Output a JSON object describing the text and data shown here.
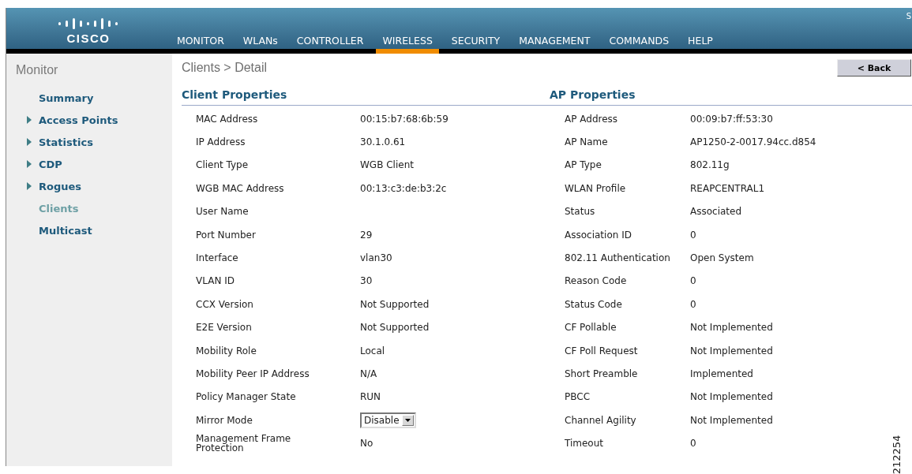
{
  "header": {
    "logo": "CISCO",
    "corner_text": "S",
    "menu": [
      {
        "label": "MONITOR",
        "selected": false
      },
      {
        "label": "WLANs",
        "selected": false
      },
      {
        "label": "CONTROLLER",
        "selected": false
      },
      {
        "label": "WIRELESS",
        "selected": true
      },
      {
        "label": "SECURITY",
        "selected": false
      },
      {
        "label": "MANAGEMENT",
        "selected": false
      },
      {
        "label": "COMMANDS",
        "selected": false
      },
      {
        "label": "HELP",
        "selected": false
      }
    ]
  },
  "sidebar": {
    "title": "Monitor",
    "items": [
      {
        "label": "Summary",
        "expandable": false,
        "selected": false
      },
      {
        "label": "Access Points",
        "expandable": true,
        "selected": false
      },
      {
        "label": "Statistics",
        "expandable": true,
        "selected": false
      },
      {
        "label": "CDP",
        "expandable": true,
        "selected": false
      },
      {
        "label": "Rogues",
        "expandable": true,
        "selected": false
      },
      {
        "label": "Clients",
        "expandable": false,
        "selected": true
      },
      {
        "label": "Multicast",
        "expandable": false,
        "selected": false
      }
    ]
  },
  "page": {
    "breadcrumb": "Clients > Detail",
    "back_button": "< Back",
    "sections": [
      {
        "title": "Client Properties",
        "rows": [
          {
            "label": "MAC Address",
            "value": "00:15:b7:68:6b:59"
          },
          {
            "label": "IP Address",
            "value": "30.1.0.61"
          },
          {
            "label": "Client Type",
            "value": "WGB Client"
          },
          {
            "label": "WGB MAC Address",
            "value": "00:13:c3:de:b3:2c"
          },
          {
            "label": "User Name"
          },
          {
            "label": "Port Number",
            "value": "29"
          },
          {
            "label": "Interface",
            "value": "vlan30"
          },
          {
            "label": "VLAN ID",
            "value": "30"
          },
          {
            "label": "CCX Version",
            "value": "Not Supported"
          },
          {
            "label": "E2E Version",
            "value": "Not Supported"
          },
          {
            "label": "Mobility Role",
            "value": "Local"
          },
          {
            "label": "Mobility Peer IP Address",
            "value": "N/A"
          },
          {
            "label": "Policy Manager State",
            "value": "RUN"
          },
          {
            "label": "Mirror Mode",
            "value": "Disable",
            "kind": "select"
          },
          {
            "label": "Management Frame Protection",
            "value": "No"
          }
        ]
      },
      {
        "title": "AP Properties",
        "rows": [
          {
            "label": "AP Address",
            "value": "00:09:b7:ff:53:30"
          },
          {
            "label": "AP Name",
            "value": "AP1250-2-0017.94cc.d854"
          },
          {
            "label": "AP Type",
            "value": "802.11g"
          },
          {
            "label": "WLAN Profile",
            "value": "REAPCENTRAL1"
          },
          {
            "label": "Status",
            "value": "Associated"
          },
          {
            "label": "Association ID",
            "value": "0"
          },
          {
            "label": "802.11 Authentication",
            "value": "Open System"
          },
          {
            "label": "Reason Code",
            "value": "0"
          },
          {
            "label": "Status Code",
            "value": "0"
          },
          {
            "label": "CF Pollable",
            "value": "Not Implemented"
          },
          {
            "label": "CF Poll Request",
            "value": "Not Implemented"
          },
          {
            "label": "Short Preamble",
            "value": "Implemented"
          },
          {
            "label": "PBCC",
            "value": "Not Implemented"
          },
          {
            "label": "Channel Agility",
            "value": "Not Implemented"
          },
          {
            "label": "Timeout",
            "value": "0"
          }
        ]
      }
    ]
  },
  "figure_id": "212254"
}
